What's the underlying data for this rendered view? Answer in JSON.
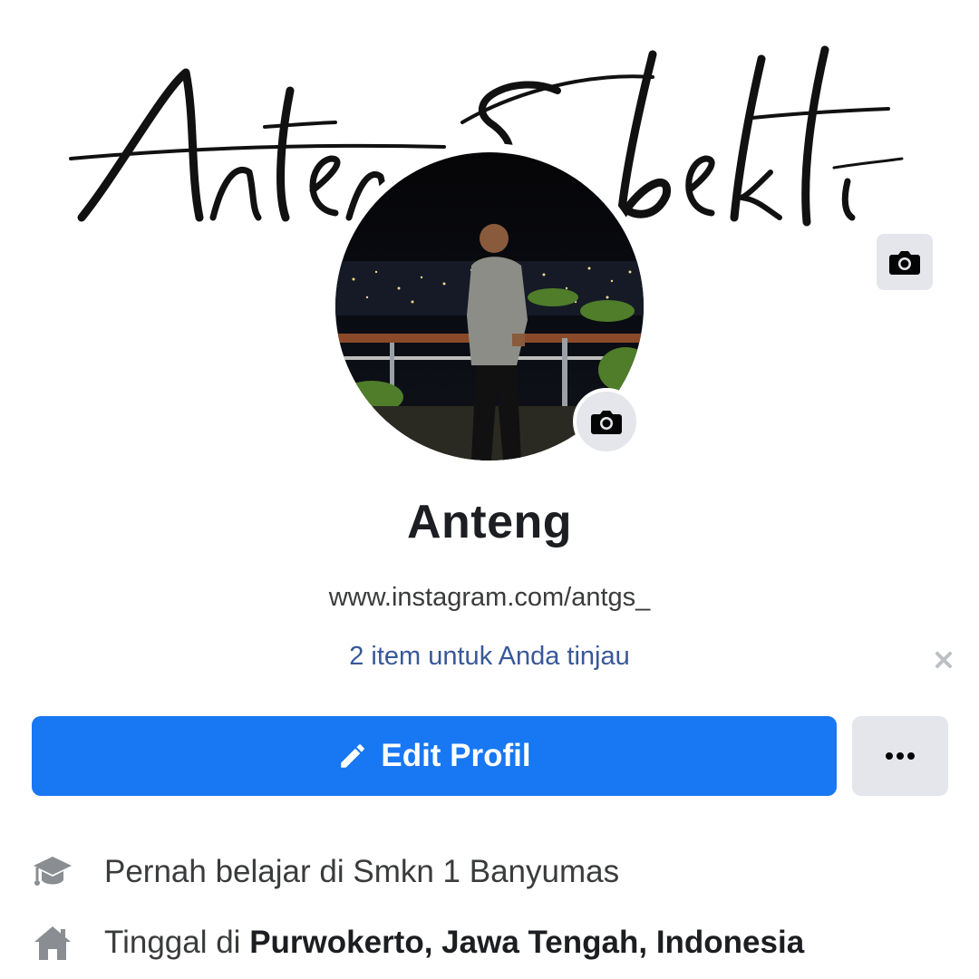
{
  "cover": {
    "signature_text": "Anteng Sbekti",
    "camera_icon": "camera-icon"
  },
  "profile": {
    "name": "Anteng",
    "bio": "www.instagram.com/antgs_",
    "review_link": "2 item untuk Anda tinjau",
    "avatar_camera_icon": "camera-icon"
  },
  "actions": {
    "edit_label": "Edit Profil",
    "edit_icon": "pencil-icon",
    "more_icon": "more-dots-icon"
  },
  "info": {
    "education": {
      "icon": "graduation-cap-icon",
      "text": "Pernah belajar di Smkn 1 Banyumas"
    },
    "residence": {
      "icon": "home-icon",
      "prefix": "Tinggal di ",
      "place": "Purwokerto, Jawa Tengah, Indonesia"
    }
  },
  "colors": {
    "primary": "#1877f2",
    "secondary_button": "#e4e6eb",
    "link": "#385898",
    "text_secondary": "#3a3b3c"
  }
}
